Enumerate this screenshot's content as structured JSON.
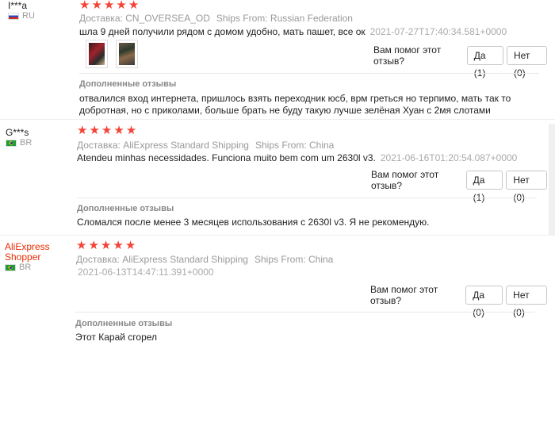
{
  "reviews": [
    {
      "user": "I***a",
      "country": "RU",
      "rating": 5,
      "delivery": "Доставка: CN_OVERSEA_OD",
      "ships_from": "Ships From: Russian Federation",
      "text": "шла 9 дней получили рядом с домом удобно, мать пашет, все ок",
      "time": "2021-07-27T17:40:34.581+0000",
      "photos": 2,
      "helpful_label": "Вам помог этот отзыв?",
      "yes_label": "Да (1)",
      "no_label": "Нет (0)",
      "additional_title": "Дополненные отзывы",
      "additional_text": "отвалился вход интернета, пришлось взять переходник юсб, врм греться но терпимо, мать так то добротная, но с приколами, больше брать не буду такую лучше зелёная Хуан с 2мя слотами"
    },
    {
      "user": "G***s",
      "country": "BR",
      "rating": 5,
      "delivery": "Доставка: AliExpress Standard Shipping",
      "ships_from": "Ships From: China",
      "text": "Atendeu minhas necessidades. Funciona muito bem com um 2630l v3.",
      "time": "2021-06-16T01:20:54.087+0000",
      "helpful_label": "Вам помог этот отзыв?",
      "yes_label": "Да (1)",
      "no_label": "Нет (0)",
      "additional_title": "Дополненные отзывы",
      "additional_text": "Сломался после менее 3 месяцев использования с 2630l v3. Я не рекомендую."
    },
    {
      "user": "AliExpress Shopper",
      "user_line1": "AliExpress",
      "user_line2": "Shopper",
      "country": "BR",
      "rating": 5,
      "delivery": "Доставка: AliExpress Standard Shipping",
      "ships_from": "Ships From: China",
      "time": "2021-06-13T14:47:11.391+0000",
      "helpful_label": "Вам помог этот отзыв?",
      "yes_label": "Да (0)",
      "no_label": "Нет (0)",
      "additional_title": "Дополненные отзывы",
      "additional_text": "Этот Карай сгорел"
    }
  ],
  "colors": {
    "star": "#f44336",
    "shopper_name": "#e62e04",
    "meta_text": "#999999"
  },
  "icons": {
    "star": "star-icon",
    "flag_ru": "flag-ru-icon",
    "flag_br": "flag-br-icon"
  }
}
